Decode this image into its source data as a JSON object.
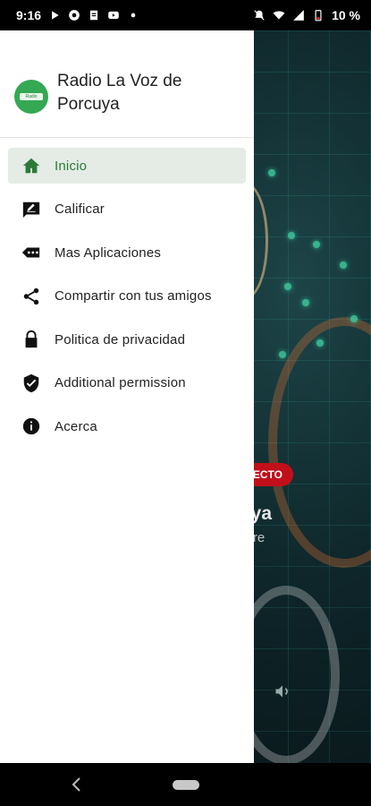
{
  "status_bar": {
    "time": "9:16",
    "battery_percent": "10 %",
    "left_icons": [
      "play-icon",
      "gear-badge-icon",
      "document-icon",
      "youtube-icon",
      "dot-icon"
    ],
    "right_icons": [
      "mute-icon",
      "wifi-icon",
      "signal-4g-icon",
      "battery-icon"
    ],
    "signal_label": "4G"
  },
  "background": {
    "live_badge": "ECTO",
    "title": "rcuya",
    "subtitle": "mpre",
    "accent": "#c0101a"
  },
  "drawer": {
    "app_name": "Radio La Voz de Porcuya",
    "logo_text": "Radio",
    "items": [
      {
        "label": "Inicio",
        "icon": "home-icon",
        "active": true
      },
      {
        "label": "Calificar",
        "icon": "rate-icon",
        "active": false
      },
      {
        "label": "Mas Aplicaciones",
        "icon": "more-apps-icon",
        "active": false
      },
      {
        "label": "Compartir con tus amigos",
        "icon": "share-icon",
        "active": false
      },
      {
        "label": "Politica de privacidad",
        "icon": "lock-icon",
        "active": false
      },
      {
        "label": "Additional permission",
        "icon": "shield-check-icon",
        "active": false
      },
      {
        "label": "Acerca",
        "icon": "info-icon",
        "active": false
      }
    ],
    "active_color": "#2b7a3a"
  }
}
